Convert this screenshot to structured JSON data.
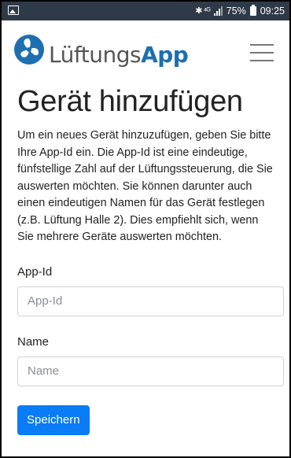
{
  "status_bar": {
    "battery_percent": "75%",
    "time": "09:25",
    "network_symbols": "✱ ⁴ᴳ"
  },
  "navbar": {
    "brand_part1": "Lüftungs",
    "brand_part2": "App"
  },
  "page": {
    "title": "Gerät hinzufügen",
    "intro": "Um ein neues Gerät hinzuzufügen, geben Sie bitte Ihre App-Id ein. Die App-Id ist eine eindeutige, fünfstellige Zahl auf der Lüftungssteuerung, die Sie auswerten möchten. Sie können darunter auch einen eindeutigen Namen für das Gerät festlegen (z.B. Lüftung Halle 2). Dies empfiehlt sich, wenn Sie mehrere Geräte auswerten möchten."
  },
  "form": {
    "app_id_label": "App-Id",
    "app_id_placeholder": "App-Id",
    "app_id_value": "",
    "name_label": "Name",
    "name_placeholder": "Name",
    "name_value": "",
    "submit_label": "Speichern"
  },
  "colors": {
    "brand_accent": "#1d6fb0",
    "button_primary": "#0a7cf5",
    "status_bar": "#2e3a47"
  }
}
